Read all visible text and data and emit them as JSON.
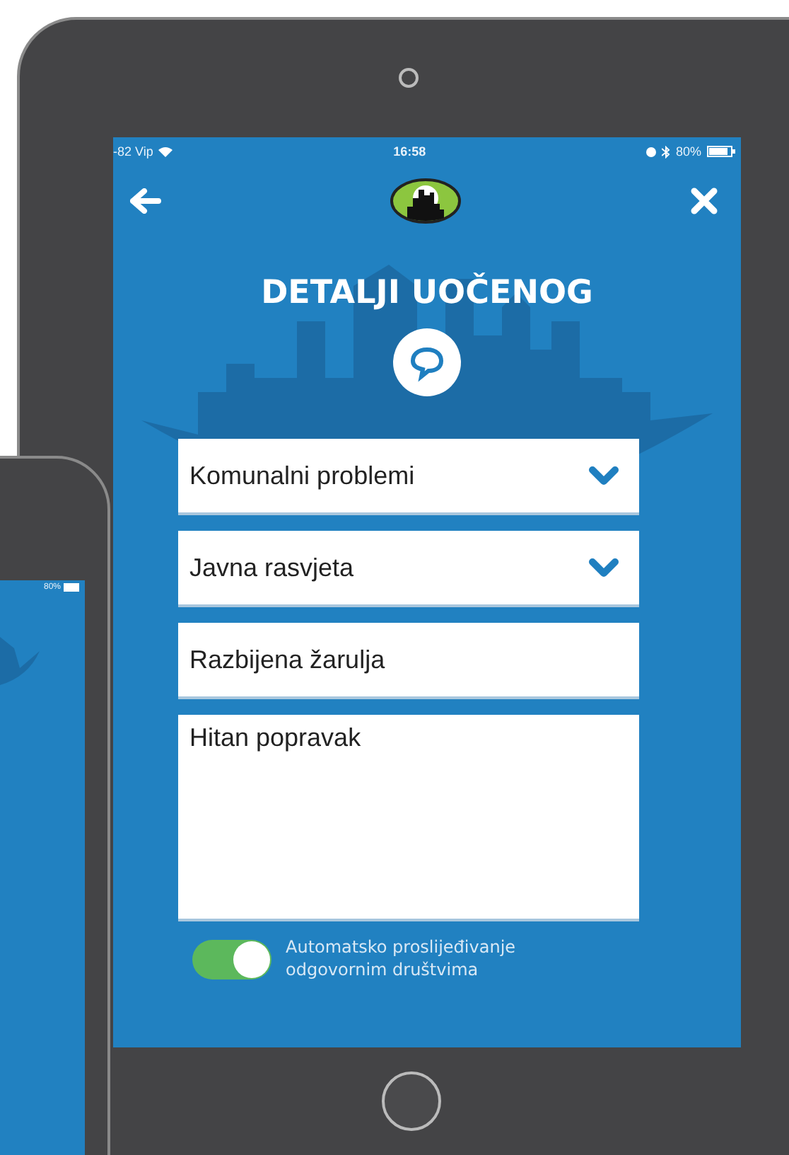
{
  "status_bar": {
    "carrier": "-82 Vip",
    "time": "16:58",
    "battery": "80%"
  },
  "title": "DETALJI UOČENOG",
  "fields": [
    {
      "kind": "select",
      "value": "Komunalni problemi"
    },
    {
      "kind": "select",
      "value": "Javna rasvjeta"
    },
    {
      "kind": "text",
      "value": "Razbijena žarulja"
    },
    {
      "kind": "textarea",
      "value": "Hitan popravak"
    }
  ],
  "toggle": {
    "label": "Automatsko proslijeđivanje odgovornim društvima",
    "on": true
  },
  "phone": {
    "battery": "80%"
  }
}
